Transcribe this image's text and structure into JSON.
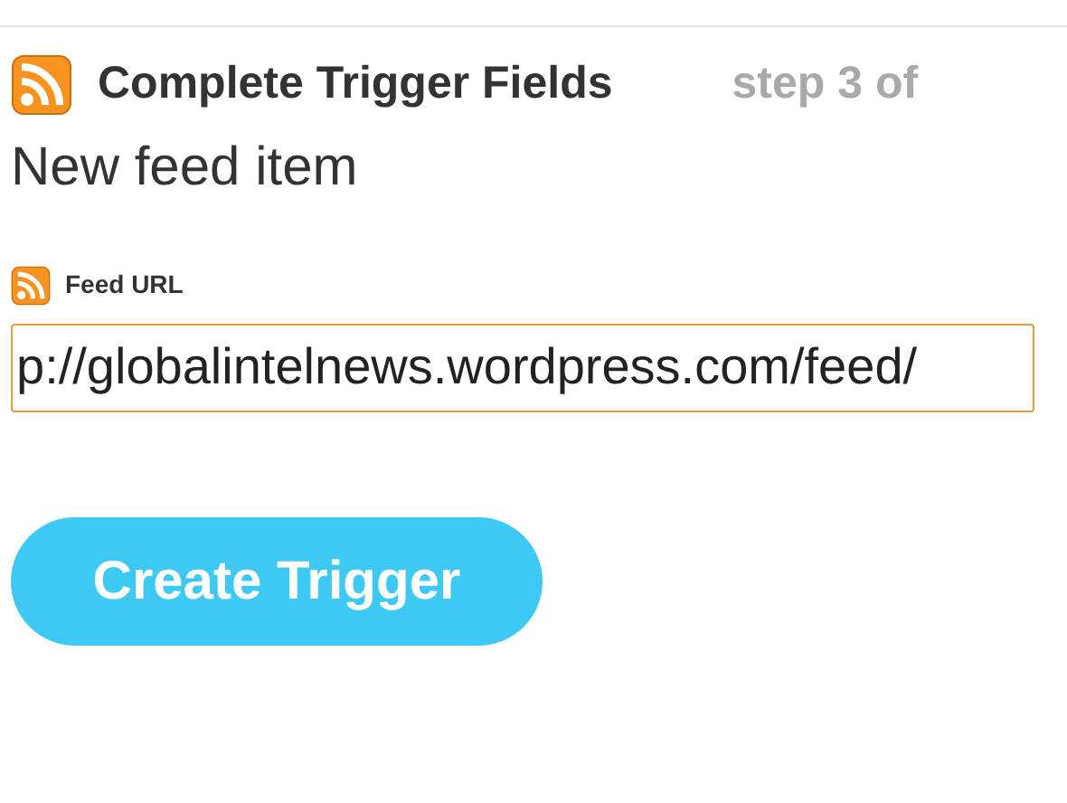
{
  "header": {
    "title": "Complete Trigger Fields",
    "step": "step 3 of"
  },
  "subtitle": "New feed item",
  "field": {
    "label": "Feed URL",
    "value": "p://globalintelnews.wordpress.com/feed/"
  },
  "button": {
    "label": "Create Trigger"
  }
}
